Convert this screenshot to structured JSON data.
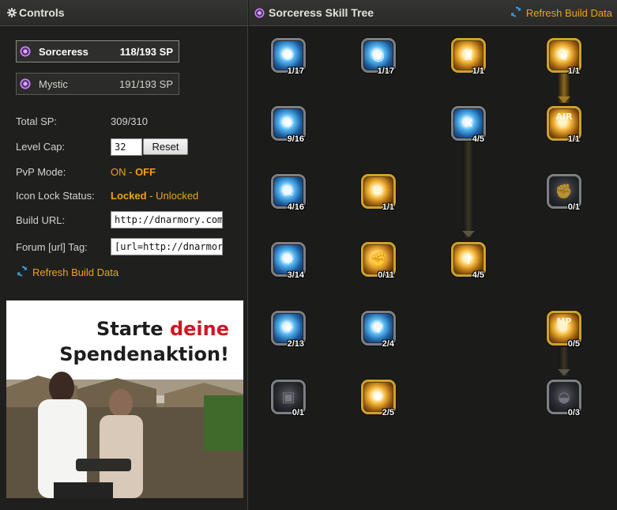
{
  "controls": {
    "title": "Controls",
    "classes": [
      {
        "name": "Sorceress",
        "sp": "118/193 SP",
        "active": true
      },
      {
        "name": "Mystic",
        "sp": "191/193 SP",
        "active": false
      }
    ],
    "total_sp_label": "Total SP:",
    "total_sp_value": "309/310",
    "level_cap_label": "Level Cap:",
    "level_cap_value": "32",
    "reset_label": "Reset",
    "pvp_label": "PvP Mode:",
    "pvp_on": "ON",
    "pvp_sep": " - ",
    "pvp_off": "OFF",
    "icon_lock_label": "Icon Lock Status:",
    "locked": "Locked",
    "lock_sep": " - ",
    "unlocked": "Unlocked",
    "build_url_label": "Build URL:",
    "build_url_value": "http://dnarmory.com/sk",
    "forum_label": "Forum [url] Tag:",
    "forum_value": "[url=http://dnarmory.cor",
    "refresh_label": "Refresh Build Data"
  },
  "ad": {
    "line1_a": "Starte ",
    "line1_b": "deine",
    "line2": "Spendenaktion!"
  },
  "tree": {
    "title": "Sorceress Skill Tree",
    "refresh_label": "Refresh Build Data",
    "skills": [
      {
        "count": "1/17",
        "style": "blue",
        "icon": "burst-icon"
      },
      {
        "count": "1/17",
        "style": "blue",
        "icon": "orb-icon"
      },
      {
        "count": "1/1",
        "style": "yellow",
        "icon": "stance-icon"
      },
      {
        "count": "1/1",
        "style": "yellow",
        "icon": "spirit-icon"
      },
      {
        "count": "9/16",
        "style": "blue",
        "icon": "scatter-icon"
      },
      {
        "count": "4/5",
        "style": "blue",
        "icon": "cross-icon"
      },
      {
        "count": "1/1",
        "style": "yellow",
        "icon": "air-icon"
      },
      {
        "count": "4/16",
        "style": "blue",
        "icon": "skull-icon"
      },
      {
        "count": "1/1",
        "style": "yellow",
        "icon": "radiance-icon"
      },
      {
        "count": "0/1",
        "style": "dim",
        "icon": "arm-icon"
      },
      {
        "count": "3/14",
        "style": "blue",
        "icon": "vortex-icon"
      },
      {
        "count": "0/11",
        "style": "yellow",
        "icon": "fist-icon"
      },
      {
        "count": "4/5",
        "style": "yellow",
        "icon": "figure-icon"
      },
      {
        "count": "2/13",
        "style": "blue",
        "icon": "spike-icon"
      },
      {
        "count": "2/4",
        "style": "blue",
        "icon": "dancer-icon"
      },
      {
        "count": "0/5",
        "style": "yellow",
        "icon": "mp-icon"
      },
      {
        "count": "0/1",
        "style": "dim",
        "icon": "shield-icon"
      },
      {
        "count": "2/5",
        "style": "yellow",
        "icon": "flare-icon"
      },
      {
        "count": "0/3",
        "style": "dim",
        "icon": "claw-icon"
      }
    ],
    "skill_glyphs": {
      "air-icon": "AIR",
      "mp-icon": "MP"
    }
  }
}
